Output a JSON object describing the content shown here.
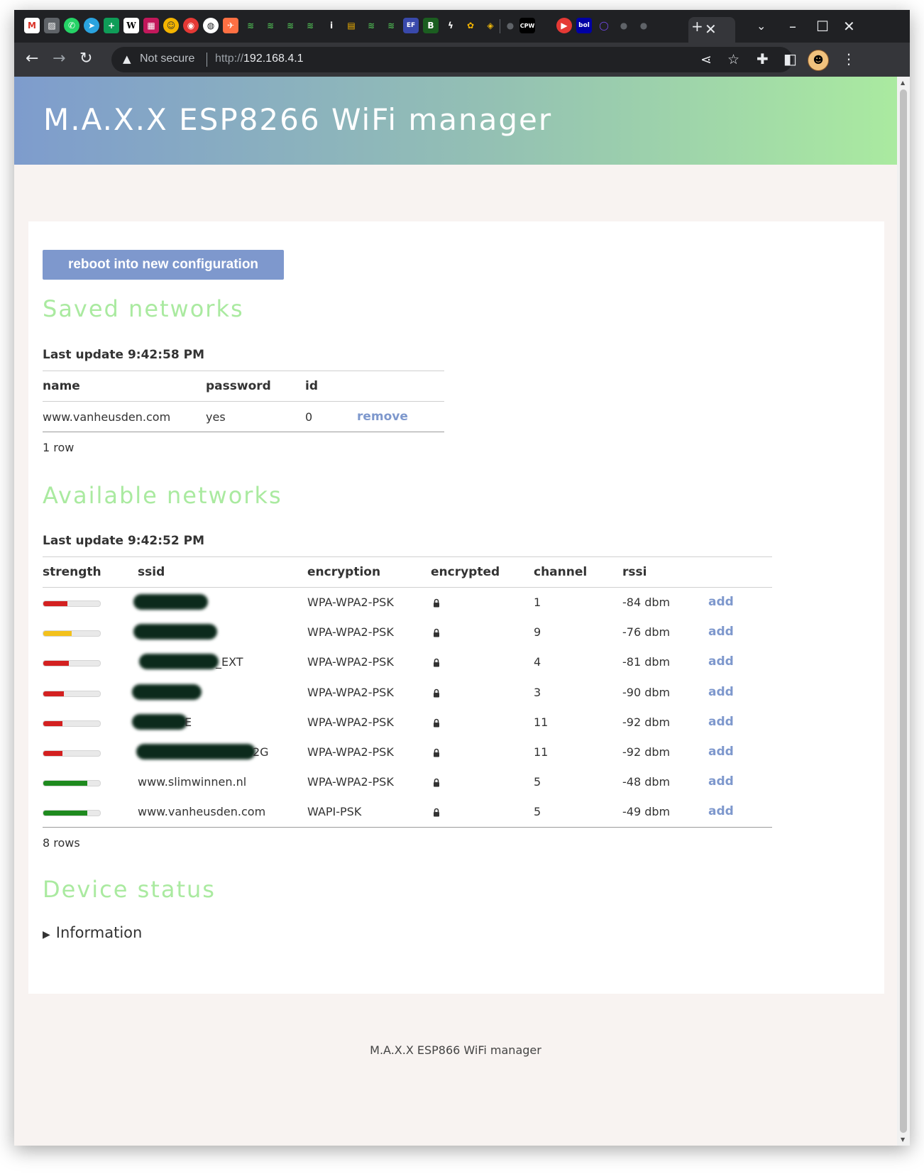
{
  "browser": {
    "address": {
      "warning": "Not secure",
      "protocol": "http://",
      "host": "192.168.4.1"
    }
  },
  "page": {
    "title": "M.A.X.X ESP8266 WiFi manager",
    "reboot_button": "reboot into new configuration",
    "saved": {
      "title": "Saved networks",
      "last_update": "Last update 9:42:58 PM",
      "columns": [
        "name",
        "password",
        "id"
      ],
      "rows": [
        {
          "name": "www.vanheusden.com",
          "password": "yes",
          "id": "0",
          "action": "remove"
        }
      ],
      "row_count": "1 row"
    },
    "available": {
      "title": "Available networks",
      "last_update": "Last update 9:42:52 PM",
      "columns": [
        "strength",
        "ssid",
        "encryption",
        "encrypted",
        "channel",
        "rssi"
      ],
      "rows": [
        {
          "strength": 0.42,
          "strength_color": "#d32020",
          "ssid_visible": "",
          "ssid_redacted": true,
          "encryption": "WPA-WPA2-PSK",
          "encrypted": true,
          "channel": "1",
          "rssi": "-84 dbm",
          "action": "add"
        },
        {
          "strength": 0.5,
          "strength_color": "#f3c11c",
          "ssid_visible": "",
          "ssid_redacted": true,
          "encryption": "WPA-WPA2-PSK",
          "encrypted": true,
          "channel": "9",
          "rssi": "-76 dbm",
          "action": "add"
        },
        {
          "strength": 0.45,
          "strength_color": "#d32020",
          "ssid_visible": "_EXT",
          "ssid_redacted": true,
          "encryption": "WPA-WPA2-PSK",
          "encrypted": true,
          "channel": "4",
          "rssi": "-81 dbm",
          "action": "add"
        },
        {
          "strength": 0.36,
          "strength_color": "#d32020",
          "ssid_visible": "",
          "ssid_redacted": true,
          "encryption": "WPA-WPA2-PSK",
          "encrypted": true,
          "channel": "3",
          "rssi": "-90 dbm",
          "action": "add"
        },
        {
          "strength": 0.34,
          "strength_color": "#d32020",
          "ssid_visible": "E",
          "ssid_redacted": true,
          "encryption": "WPA-WPA2-PSK",
          "encrypted": true,
          "channel": "11",
          "rssi": "-92 dbm",
          "action": "add"
        },
        {
          "strength": 0.34,
          "strength_color": "#d32020",
          "ssid_visible": "2G",
          "ssid_redacted": true,
          "encryption": "WPA-WPA2-PSK",
          "encrypted": true,
          "channel": "11",
          "rssi": "-92 dbm",
          "action": "add"
        },
        {
          "strength": 0.78,
          "strength_color": "#1e8a1e",
          "ssid_visible": "www.slimwinnen.nl",
          "ssid_redacted": false,
          "encryption": "WPA-WPA2-PSK",
          "encrypted": true,
          "channel": "5",
          "rssi": "-48 dbm",
          "action": "add"
        },
        {
          "strength": 0.78,
          "strength_color": "#1e8a1e",
          "ssid_visible": "www.vanheusden.com",
          "ssid_redacted": false,
          "encryption": "WAPI-PSK",
          "encrypted": true,
          "channel": "5",
          "rssi": "-49 dbm",
          "action": "add"
        }
      ],
      "row_count": "8 rows"
    },
    "device": {
      "title": "Device status",
      "details_summary": "Information"
    },
    "footer": "M.A.X.X ESP866 WiFi manager"
  },
  "colors": {
    "accent_green": "#aaeaa0",
    "accent_blue": "#7e98cd",
    "background": "#f8f3f1"
  },
  "icons": {
    "tabs": [
      "gmail-icon",
      "image-icon",
      "whatsapp-icon",
      "telegram-icon",
      "add-icon",
      "wikipedia-icon",
      "app-icon",
      "face-icon",
      "target-icon",
      "globe-icon",
      "flight-icon",
      "signal-icon",
      "signal-icon",
      "signal-icon",
      "signal-icon",
      "info-icon",
      "grid-icon",
      "signal-icon",
      "signal-icon",
      "ef-icon",
      "b-icon",
      "bolt-icon",
      "flower-icon",
      "binance-icon",
      "github-icon",
      "cpw-icon",
      "youtube-icon",
      "bol-icon",
      "circle-icon",
      "github-icon",
      "github-icon"
    ]
  }
}
